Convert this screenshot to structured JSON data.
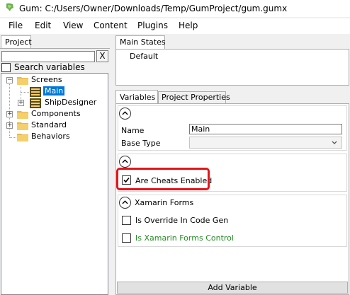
{
  "window": {
    "title": "Gum: C:/Users/Owner/Downloads/Temp/GumProject/gum.gumx"
  },
  "menu": {
    "items": [
      {
        "label": "File"
      },
      {
        "label": "Edit"
      },
      {
        "label": "View"
      },
      {
        "label": "Content"
      },
      {
        "label": "Plugins"
      },
      {
        "label": "Help"
      }
    ]
  },
  "project_panel": {
    "tab_label": "Project",
    "search": {
      "value": "",
      "clear_label": "X"
    },
    "search_variables_label": "Search variables",
    "search_variables_checked": false,
    "tree": [
      {
        "label": "Screens",
        "icon": "folder-icon",
        "expanded": true
      },
      {
        "label": "Main",
        "icon": "screen-icon",
        "selected": true
      },
      {
        "label": "ShipDesigner",
        "icon": "screen-icon",
        "expanded": false
      },
      {
        "label": "Components",
        "icon": "folder-icon",
        "expanded": false
      },
      {
        "label": "Standard",
        "icon": "folder-icon",
        "expanded": false
      },
      {
        "label": "Behaviors",
        "icon": "folder-icon"
      }
    ]
  },
  "states_panel": {
    "tab_label": "Main States",
    "states": [
      "Default"
    ]
  },
  "properties_panel": {
    "tabs": [
      {
        "label": "Variables",
        "active": true
      },
      {
        "label": "Project Properties",
        "active": false
      }
    ],
    "group1": {
      "name_label": "Name",
      "name_value": "Main",
      "base_type_label": "Base Type",
      "base_type_value": ""
    },
    "group2": {
      "cheats_label": "Are Cheats Enabled",
      "cheats_checked": true
    },
    "group3": {
      "title": "Xamarin Forms",
      "override_label": "Is Override In Code Gen",
      "override_checked": false,
      "xamarin_control_label": "Is Xamarin Forms Control",
      "xamarin_control_checked": false
    },
    "add_variable_label": "Add Variable"
  },
  "colors": {
    "highlight_border": "#e5141a",
    "selection": "#0078d7",
    "green_text": "#228b22"
  }
}
